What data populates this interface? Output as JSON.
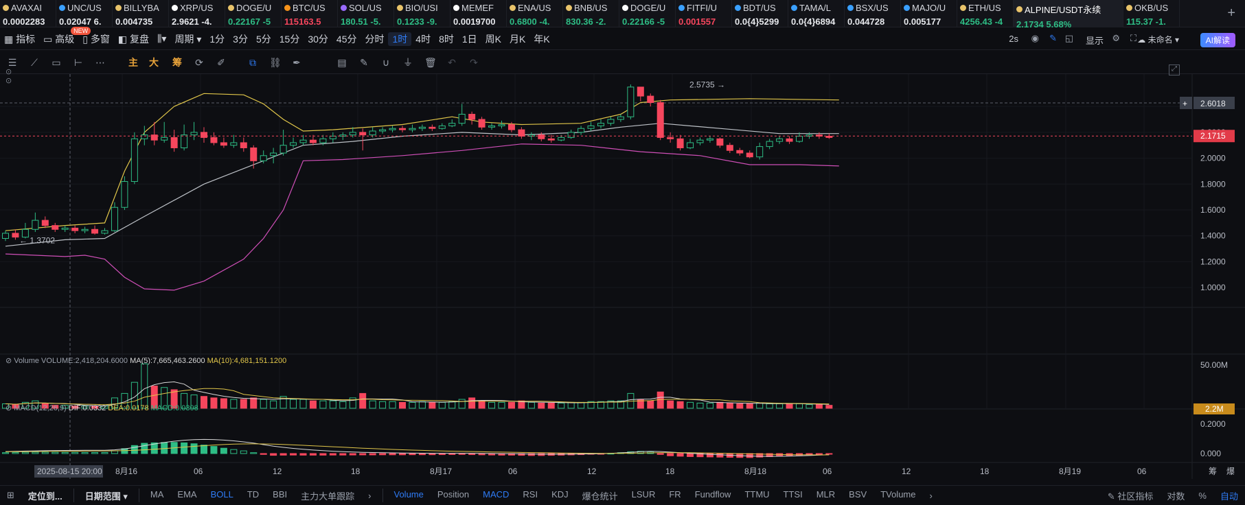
{
  "tickers": [
    {
      "name": "AVAXAI",
      "value": "0.0002283",
      "dir": "wh",
      "dot": "#e8c36a"
    },
    {
      "name": "UNC/US",
      "value": "0.02047 6.",
      "dir": "wh",
      "dot": "#3aa0ff"
    },
    {
      "name": "BILLYBA",
      "value": "0.004735",
      "dir": "wh",
      "dot": "#e8c36a"
    },
    {
      "name": "XRP/US",
      "value": "2.9621 -4.",
      "dir": "wh",
      "dot": "#ffffff"
    },
    {
      "name": "DOGE/U",
      "value": "0.22167 -5",
      "dir": "up",
      "dot": "#e8c36a"
    },
    {
      "name": "BTC/US",
      "value": "115163.5",
      "dir": "dn",
      "dot": "#f7931a"
    },
    {
      "name": "SOL/US",
      "value": "180.51 -5.",
      "dir": "up",
      "dot": "#9a6bff"
    },
    {
      "name": "BIO/USI",
      "value": "0.1233 -9.",
      "dir": "up",
      "dot": "#e8c36a"
    },
    {
      "name": "MEMEF",
      "value": "0.0019700",
      "dir": "wh",
      "dot": "#ffffff"
    },
    {
      "name": "ENA/US",
      "value": "0.6800 -4.",
      "dir": "up",
      "dot": "#e8c36a"
    },
    {
      "name": "BNB/US",
      "value": "830.36 -2.",
      "dir": "up",
      "dot": "#e8c36a"
    },
    {
      "name": "DOGE/U",
      "value": "0.22166 -5",
      "dir": "up",
      "dot": "#ffffff"
    },
    {
      "name": "FITFI/U",
      "value": "0.001557",
      "dir": "dn",
      "dot": "#3aa0ff"
    },
    {
      "name": "BDT/US",
      "value": "0.0{4}5299",
      "dir": "wh",
      "dot": "#3aa0ff"
    },
    {
      "name": "TAMA/L",
      "value": "0.0{4}6894",
      "dir": "wh",
      "dot": "#3aa0ff"
    },
    {
      "name": "BSX/US",
      "value": "0.044728",
      "dir": "wh",
      "dot": "#3aa0ff"
    },
    {
      "name": "MAJO/U",
      "value": "0.005177",
      "dir": "wh",
      "dot": "#3aa0ff"
    },
    {
      "name": "ETH/US",
      "value": "4256.43 -4",
      "dir": "up",
      "dot": "#e8c36a"
    },
    {
      "name": "ALPINE/USDT永续",
      "value": "2.1734  5.68%",
      "dir": "up",
      "dot": "#e8c36a",
      "active": true
    },
    {
      "name": "OKB/US",
      "value": "115.37 -1.",
      "dir": "up",
      "dot": "#e8c36a"
    }
  ],
  "toolbar": {
    "indicators": "指标",
    "advanced": "高级",
    "multi": "多窗",
    "restore": "复盘",
    "period": "周期",
    "new_badge": "NEW",
    "intervals": [
      "1分",
      "3分",
      "5分",
      "15分",
      "30分",
      "45分",
      "分时",
      "1时",
      "4时",
      "8时",
      "1日",
      "周K",
      "月K",
      "年K"
    ],
    "selected_interval": "1时",
    "refresh": "2s",
    "display": "显示",
    "unnamed": "未命名",
    "ai": "AI解读"
  },
  "drawbar": {
    "main": "主",
    "big": "大",
    "chips": "筹"
  },
  "legend": {
    "volume": "Volume",
    "volume_val": "VOLUME:2,418,204.6000",
    "ma5": "MA(5):7,665,463.2600",
    "ma10": "MA(10):4,681,151.1200",
    "macd": "MACD(12,26,9)",
    "dif": "DIF:0.0332",
    "dea": "DEA:0.0178",
    "macd_val": "MACD:0.0308"
  },
  "price_axis": {
    "ticks": [
      "2.4000",
      "2.2000",
      "2.0000",
      "1.8000",
      "1.6000",
      "1.4000",
      "1.2000",
      "1.0000"
    ],
    "crosshair_price": "2.6018",
    "current_price": "2.1715",
    "high_label": "2.5735",
    "low_label": "1.3702",
    "vol_tick": "50.00M",
    "vol_current": "2.2M",
    "macd_ticks": [
      "0.2000",
      "0.000"
    ]
  },
  "time_axis": {
    "labels": [
      "8月16",
      "06",
      "12",
      "18",
      "8月17",
      "06",
      "12",
      "18",
      "8月18",
      "06",
      "12",
      "18",
      "8月19",
      "06"
    ],
    "crosshair_time": "2025-08-15 20:00",
    "right": [
      "筹",
      "爆"
    ]
  },
  "bottom": {
    "locate": "定位到...",
    "range": "日期范围",
    "main_ind": [
      "MA",
      "EMA",
      "BOLL",
      "TD",
      "BBI",
      "主力大单跟踪"
    ],
    "main_active": "BOLL",
    "sub_ind": [
      "Volume",
      "Position",
      "MACD",
      "RSI",
      "KDJ",
      "爆仓统计",
      "LSUR",
      "FR",
      "Fundflow",
      "TTMU",
      "TTSI",
      "MLR",
      "BSV",
      "TVolume"
    ],
    "sub_active": [
      "Volume",
      "MACD"
    ],
    "community": "社区指标",
    "log": "对数",
    "pct": "%",
    "auto": "自动"
  },
  "colors": {
    "up": "#2ebd85",
    "down": "#f6465d",
    "ma5": "#d9d9d9",
    "ma10": "#e2c74a",
    "boll_lower": "#d04fb8"
  },
  "chart_data": {
    "type": "candlestick",
    "ylim": [
      0.9,
      2.65
    ],
    "candles": [
      [
        1.38,
        1.42,
        1.44,
        1.36
      ],
      [
        1.42,
        1.39,
        1.45,
        1.37
      ],
      [
        1.39,
        1.45,
        1.5,
        1.38
      ],
      [
        1.45,
        1.52,
        1.58,
        1.43
      ],
      [
        1.52,
        1.48,
        1.55,
        1.46
      ],
      [
        1.48,
        1.45,
        1.5,
        1.43
      ],
      [
        1.45,
        1.46,
        1.48,
        1.43
      ],
      [
        1.46,
        1.44,
        1.48,
        1.42
      ],
      [
        1.44,
        1.45,
        1.47,
        1.42
      ],
      [
        1.45,
        1.42,
        1.48,
        1.41
      ],
      [
        1.42,
        1.44,
        1.46,
        1.41
      ],
      [
        1.44,
        1.62,
        1.66,
        1.43
      ],
      [
        1.62,
        1.82,
        1.86,
        1.6
      ],
      [
        1.82,
        2.15,
        2.2,
        1.8
      ],
      [
        2.15,
        2.18,
        2.25,
        2.1
      ],
      [
        2.18,
        2.14,
        2.28,
        2.1
      ],
      [
        2.14,
        2.16,
        2.28,
        2.12
      ],
      [
        2.16,
        2.08,
        2.22,
        2.05
      ],
      [
        2.08,
        2.18,
        2.26,
        2.06
      ],
      [
        2.18,
        2.2,
        2.28,
        2.14
      ],
      [
        2.2,
        2.16,
        2.24,
        2.12
      ],
      [
        2.16,
        2.12,
        2.2,
        2.1
      ],
      [
        2.12,
        2.1,
        2.16,
        2.08
      ],
      [
        2.1,
        2.12,
        2.18,
        2.08
      ],
      [
        2.12,
        2.08,
        2.16,
        2.05
      ],
      [
        2.08,
        1.98,
        2.1,
        1.92
      ],
      [
        1.98,
        2.02,
        2.06,
        1.96
      ],
      [
        2.02,
        2.04,
        2.08,
        1.96
      ],
      [
        2.04,
        2.1,
        2.22,
        2.02
      ],
      [
        2.1,
        2.12,
        2.16,
        2.08
      ],
      [
        2.12,
        2.14,
        2.18,
        2.1
      ],
      [
        2.14,
        2.12,
        2.18,
        2.1
      ],
      [
        2.12,
        2.15,
        2.18,
        2.1
      ],
      [
        2.15,
        2.17,
        2.2,
        2.12
      ],
      [
        2.17,
        2.18,
        2.2,
        2.14
      ],
      [
        2.18,
        2.2,
        2.24,
        2.16
      ],
      [
        2.2,
        2.18,
        2.23,
        2.06
      ],
      [
        2.18,
        2.21,
        2.24,
        2.16
      ],
      [
        2.21,
        2.22,
        2.24,
        2.19
      ],
      [
        2.22,
        2.23,
        2.25,
        2.2
      ],
      [
        2.23,
        2.22,
        2.25,
        2.2
      ],
      [
        2.22,
        2.23,
        2.26,
        2.2
      ],
      [
        2.23,
        2.24,
        2.26,
        2.21
      ],
      [
        2.24,
        2.23,
        2.26,
        2.21
      ],
      [
        2.23,
        2.25,
        2.27,
        2.22
      ],
      [
        2.25,
        2.27,
        2.3,
        2.24
      ],
      [
        2.27,
        2.34,
        2.42,
        2.25
      ],
      [
        2.34,
        2.3,
        2.36,
        2.26
      ],
      [
        2.3,
        2.24,
        2.32,
        2.22
      ],
      [
        2.24,
        2.25,
        2.27,
        2.22
      ],
      [
        2.25,
        2.26,
        2.29,
        2.23
      ],
      [
        2.26,
        2.22,
        2.28,
        2.2
      ],
      [
        2.22,
        2.17,
        2.24,
        2.15
      ],
      [
        2.17,
        2.18,
        2.2,
        2.14
      ],
      [
        2.18,
        2.15,
        2.2,
        2.13
      ],
      [
        2.15,
        2.14,
        2.18,
        2.12
      ],
      [
        2.14,
        2.16,
        2.18,
        2.13
      ],
      [
        2.16,
        2.2,
        2.22,
        2.15
      ],
      [
        2.2,
        2.23,
        2.25,
        2.18
      ],
      [
        2.23,
        2.25,
        2.28,
        2.21
      ],
      [
        2.25,
        2.27,
        2.3,
        2.23
      ],
      [
        2.27,
        2.3,
        2.32,
        2.25
      ],
      [
        2.3,
        2.32,
        2.34,
        2.28
      ],
      [
        2.32,
        2.55,
        2.57,
        2.3
      ],
      [
        2.55,
        2.48,
        2.52,
        2.44
      ],
      [
        2.48,
        2.43,
        2.5,
        2.4
      ],
      [
        2.43,
        2.16,
        2.45,
        2.14
      ],
      [
        2.16,
        2.15,
        2.2,
        2.12
      ],
      [
        2.15,
        2.08,
        2.18,
        2.06
      ],
      [
        2.08,
        2.12,
        2.15,
        2.07
      ],
      [
        2.12,
        2.14,
        2.16,
        2.1
      ],
      [
        2.14,
        2.15,
        2.17,
        2.12
      ],
      [
        2.15,
        2.1,
        2.16,
        2.08
      ],
      [
        2.1,
        2.06,
        2.12,
        2.04
      ],
      [
        2.06,
        2.04,
        2.08,
        2.02
      ],
      [
        2.04,
        2.01,
        2.06,
        2.0
      ],
      [
        2.01,
        2.09,
        2.12,
        1.99
      ],
      [
        2.09,
        2.13,
        2.15,
        2.07
      ],
      [
        2.13,
        2.15,
        2.17,
        2.11
      ],
      [
        2.15,
        2.13,
        2.17,
        2.11
      ],
      [
        2.13,
        2.17,
        2.2,
        2.12
      ],
      [
        2.17,
        2.18,
        2.2,
        2.15
      ],
      [
        2.18,
        2.17,
        2.2,
        2.15
      ],
      [
        2.17,
        2.16,
        2.19,
        2.15
      ]
    ],
    "boll_upper": [
      [
        0,
        1.44
      ],
      [
        6,
        1.48
      ],
      [
        10,
        1.5
      ],
      [
        12,
        1.9
      ],
      [
        14,
        2.2
      ],
      [
        17,
        2.4
      ],
      [
        20,
        2.5
      ],
      [
        24,
        2.49
      ],
      [
        26,
        2.42
      ],
      [
        28,
        2.3
      ],
      [
        30,
        2.21
      ],
      [
        33,
        2.22
      ],
      [
        40,
        2.26
      ],
      [
        45,
        2.32
      ],
      [
        48,
        2.28
      ],
      [
        52,
        2.26
      ],
      [
        58,
        2.27
      ],
      [
        62,
        2.34
      ],
      [
        64,
        2.43
      ],
      [
        67,
        2.45
      ],
      [
        75,
        2.46
      ],
      [
        84,
        2.45
      ]
    ],
    "boll_mid": [
      [
        0,
        1.32
      ],
      [
        6,
        1.37
      ],
      [
        10,
        1.38
      ],
      [
        14,
        1.55
      ],
      [
        20,
        1.8
      ],
      [
        26,
        1.98
      ],
      [
        30,
        2.1
      ],
      [
        35,
        2.13
      ],
      [
        40,
        2.17
      ],
      [
        46,
        2.2
      ],
      [
        52,
        2.18
      ],
      [
        58,
        2.2
      ],
      [
        62,
        2.24
      ],
      [
        66,
        2.27
      ],
      [
        72,
        2.23
      ],
      [
        78,
        2.19
      ],
      [
        84,
        2.19
      ]
    ],
    "boll_lower": [
      [
        0,
        1.26
      ],
      [
        6,
        1.24
      ],
      [
        8,
        1.25
      ],
      [
        10,
        1.22
      ],
      [
        12,
        1.08
      ],
      [
        14,
        0.99
      ],
      [
        17,
        0.98
      ],
      [
        20,
        1.05
      ],
      [
        24,
        1.22
      ],
      [
        26,
        1.38
      ],
      [
        28,
        1.6
      ],
      [
        30,
        1.98
      ],
      [
        34,
        1.99
      ],
      [
        40,
        2.02
      ],
      [
        46,
        2.06
      ],
      [
        52,
        2.11
      ],
      [
        58,
        2.1
      ],
      [
        64,
        2.05
      ],
      [
        70,
        2.02
      ],
      [
        75,
        1.95
      ],
      [
        80,
        1.95
      ],
      [
        84,
        1.94
      ]
    ],
    "volume": [
      6,
      5,
      8,
      10,
      6,
      4,
      4,
      3,
      3,
      3,
      3,
      14,
      20,
      35,
      60,
      30,
      28,
      25,
      20,
      18,
      16,
      14,
      13,
      12,
      12,
      14,
      12,
      10,
      16,
      12,
      12,
      10,
      10,
      10,
      9,
      14,
      20,
      10,
      9,
      9,
      8,
      8,
      9,
      8,
      8,
      9,
      12,
      14,
      10,
      8,
      8,
      8,
      10,
      8,
      7,
      7,
      7,
      8,
      8,
      9,
      9,
      10,
      10,
      20,
      12,
      10,
      22,
      10,
      9,
      8,
      7,
      7,
      8,
      7,
      6,
      6,
      7,
      6,
      6,
      6,
      6,
      5,
      5,
      4
    ],
    "macd_hist": [
      0.01,
      0.012,
      0.014,
      0.015,
      0.015,
      0.014,
      0.013,
      0.013,
      0.012,
      0.012,
      0.012,
      0.03,
      0.055,
      0.09,
      0.115,
      0.12,
      0.124,
      0.125,
      0.12,
      0.11,
      0.095,
      0.08,
      0.06,
      0.045,
      0.03,
      0.01,
      -0.01,
      -0.02,
      -0.018,
      -0.017,
      -0.018,
      -0.018,
      -0.018,
      -0.017,
      -0.017,
      -0.016,
      -0.015,
      -0.015,
      -0.014,
      -0.014,
      -0.014,
      -0.013,
      -0.013,
      -0.013,
      -0.012,
      -0.011,
      -0.01,
      -0.012,
      -0.014,
      -0.016,
      -0.018,
      -0.018,
      -0.02,
      -0.022,
      -0.022,
      -0.02,
      -0.018,
      -0.015,
      -0.012,
      -0.008,
      -0.004,
      0.002,
      0.01,
      0.02,
      0.025,
      0.02,
      -0.01,
      -0.025,
      -0.03,
      -0.034,
      -0.036,
      -0.038,
      -0.04,
      -0.042,
      -0.044,
      -0.045,
      -0.04,
      -0.035,
      -0.03,
      -0.025,
      -0.018,
      -0.012,
      -0.008,
      -0.004
    ]
  }
}
